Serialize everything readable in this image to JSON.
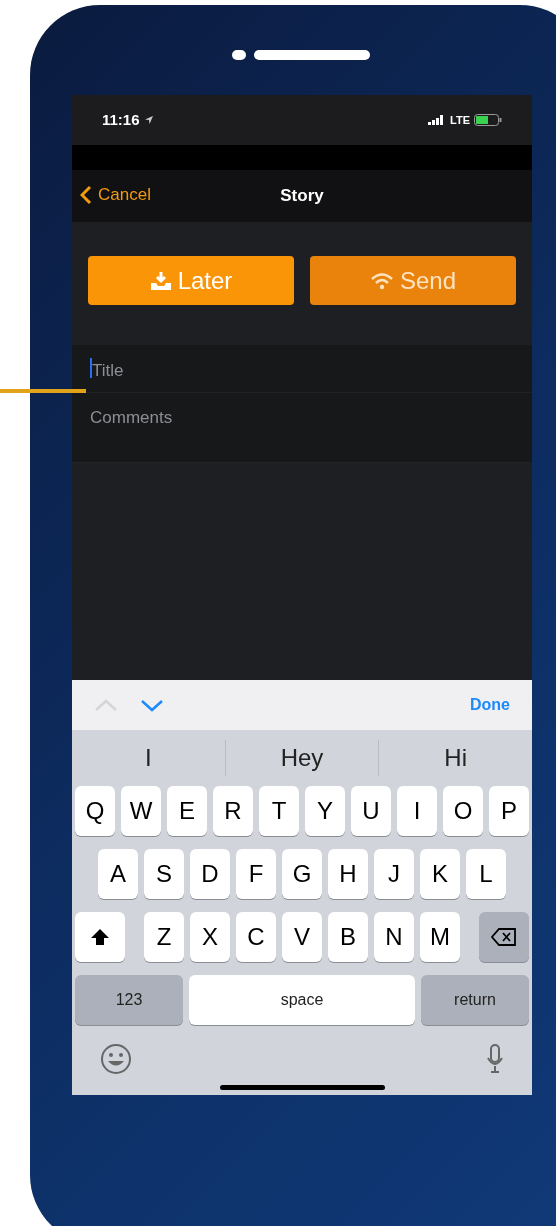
{
  "status_bar": {
    "time": "11:16",
    "network": "LTE"
  },
  "nav_bar": {
    "back": "Cancel",
    "title": "Story"
  },
  "action_buttons": [
    {
      "label": "Later",
      "kind": "download"
    },
    {
      "label": "Send",
      "kind": "wifi"
    }
  ],
  "fields": [
    {
      "placeholder": "Title",
      "focused": true
    },
    {
      "placeholder": "Comments",
      "focused": false
    }
  ],
  "keyboard_toolbar": {
    "arrows": [
      {
        "kind": "up",
        "disabled": true
      },
      {
        "kind": "down",
        "disabled": false
      }
    ],
    "done": "Done"
  },
  "suggestions": [
    "I",
    "Hey",
    "Hi"
  ],
  "key_rows": [
    [
      "Q",
      "W",
      "E",
      "R",
      "T",
      "Y",
      "U",
      "I",
      "O",
      "P"
    ],
    [
      "A",
      "S",
      "D",
      "F",
      "G",
      "H",
      "J",
      "K",
      "L"
    ],
    [
      "Z",
      "X",
      "C",
      "V",
      "B",
      "N",
      "M"
    ]
  ],
  "bottom_keys": [
    {
      "label": "123",
      "kind": "function"
    },
    {
      "label": "space",
      "kind": "space"
    },
    {
      "label": "return",
      "kind": "function"
    }
  ]
}
